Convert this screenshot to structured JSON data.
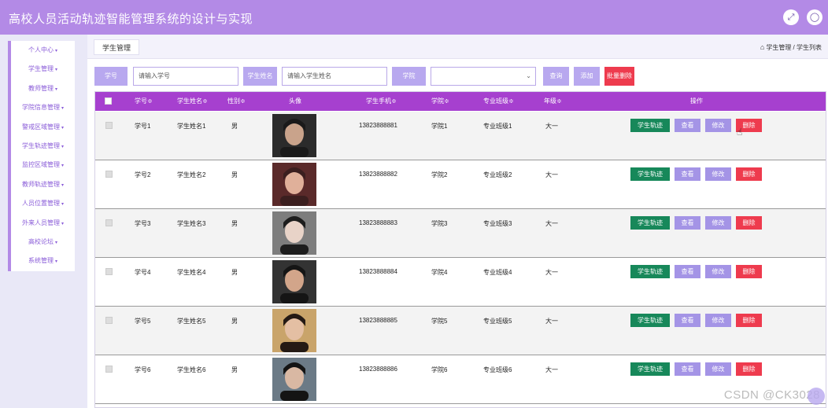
{
  "app": {
    "title": "高校人员活动轨迹智能管理系统的设计与实现"
  },
  "header_icons": {
    "fullscreen": "expand-icon",
    "user": "user-icon"
  },
  "sidebar": {
    "items": [
      {
        "label": "个人中心"
      },
      {
        "label": "学生管理"
      },
      {
        "label": "教师管理"
      },
      {
        "label": "学院信息管理"
      },
      {
        "label": "警戒区域管理"
      },
      {
        "label": "学生轨迹管理"
      },
      {
        "label": "监控区域管理"
      },
      {
        "label": "教师轨迹管理"
      },
      {
        "label": "人员位置管理"
      },
      {
        "label": "外来人员管理"
      },
      {
        "label": "高校论坛"
      },
      {
        "label": "系统管理"
      }
    ]
  },
  "tabs": {
    "active": "学生管理"
  },
  "breadcrumb": {
    "level1": "学生管理",
    "sep": " / ",
    "level2": "学生列表"
  },
  "search": {
    "id_label": "学号",
    "id_placeholder": "请输入学号",
    "name_label": "学生姓名",
    "name_placeholder": "请输入学生姓名",
    "college_label": "学院",
    "college_value": "",
    "query": "查询",
    "add": "添加",
    "batch_delete": "批量删除"
  },
  "table": {
    "headers": {
      "id": "学号≑",
      "name": "学生姓名≑",
      "gender": "性别≑",
      "avatar": "头像",
      "phone": "学生手机≑",
      "college": "学院≑",
      "class": "专业班级≑",
      "grade": "年级≑",
      "actions": "操作"
    },
    "rows": [
      {
        "id": "学号1",
        "name": "学生姓名1",
        "gender": "男",
        "phone": "13823888881",
        "college": "学院1",
        "class": "专业班级1",
        "grade": "大一"
      },
      {
        "id": "学号2",
        "name": "学生姓名2",
        "gender": "男",
        "phone": "13823888882",
        "college": "学院2",
        "class": "专业班级2",
        "grade": "大一"
      },
      {
        "id": "学号3",
        "name": "学生姓名3",
        "gender": "男",
        "phone": "13823888883",
        "college": "学院3",
        "class": "专业班级3",
        "grade": "大一"
      },
      {
        "id": "学号4",
        "name": "学生姓名4",
        "gender": "男",
        "phone": "13823888884",
        "college": "学院4",
        "class": "专业班级4",
        "grade": "大一"
      },
      {
        "id": "学号5",
        "name": "学生姓名5",
        "gender": "男",
        "phone": "13823888885",
        "college": "学院5",
        "class": "专业班级5",
        "grade": "大一"
      },
      {
        "id": "学号6",
        "name": "学生姓名6",
        "gender": "男",
        "phone": "13823888886",
        "college": "学院6",
        "class": "专业班级6",
        "grade": "大一"
      }
    ],
    "actions": {
      "track": "学生轨迹",
      "view": "查看",
      "edit": "修改",
      "delete": "删除"
    }
  },
  "watermark": "CSDN @CK3028",
  "colors": {
    "topbar": "#b38ae6",
    "table_header": "#a640cf",
    "track_button": "#17885a",
    "neutral_button": "#a494e6",
    "delete_button": "#ee3b4e"
  }
}
